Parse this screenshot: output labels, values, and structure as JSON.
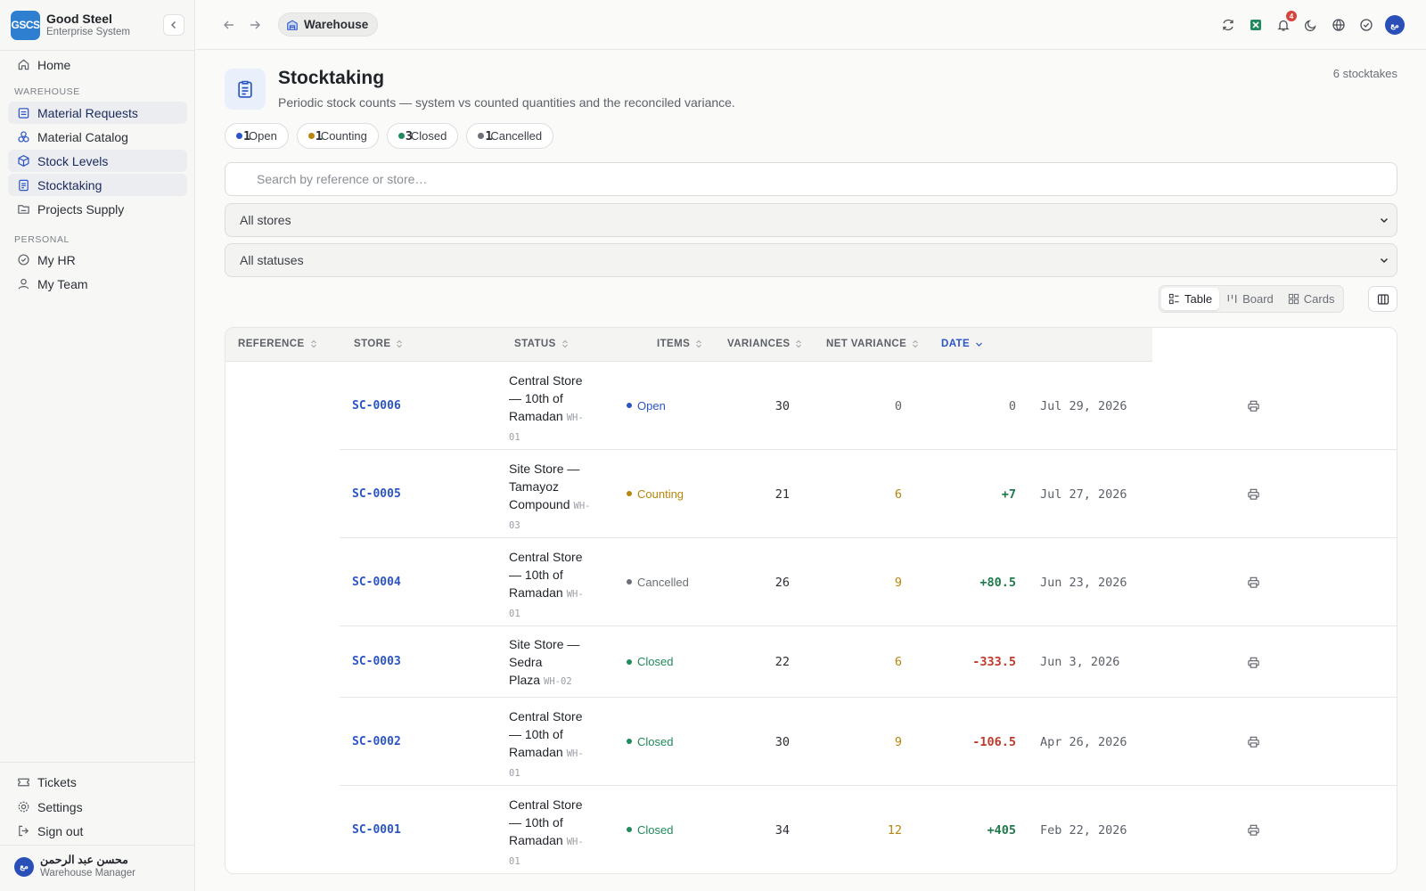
{
  "brand": {
    "logo": "GSCS",
    "name": "Good Steel",
    "subtitle": "Enterprise System"
  },
  "sidebar": {
    "home": "Home",
    "section_warehouse": "WAREHOUSE",
    "warehouse_items": [
      {
        "label": "Material Requests",
        "icon": "clipboard-icon",
        "active": true
      },
      {
        "label": "Material Catalog",
        "icon": "boxes-icon",
        "active": false
      },
      {
        "label": "Stock Levels",
        "icon": "cube-icon",
        "active": true
      },
      {
        "label": "Stocktaking",
        "icon": "checklist-icon",
        "active": true
      },
      {
        "label": "Projects Supply",
        "icon": "folder-icon",
        "active": false
      }
    ],
    "section_personal": "PERSONAL",
    "personal_items": [
      {
        "label": "My HR",
        "icon": "badge-check-icon"
      },
      {
        "label": "My Team",
        "icon": "user-icon"
      }
    ],
    "bottom_items": [
      {
        "label": "Tickets",
        "icon": "ticket-icon"
      },
      {
        "label": "Settings",
        "icon": "gear-icon"
      },
      {
        "label": "Sign out",
        "icon": "sign-out-icon"
      }
    ],
    "user": {
      "avatar": "مع",
      "name": "محسن عبد الرحمن",
      "role": "Warehouse Manager"
    }
  },
  "topbar": {
    "breadcrumb": "Warehouse",
    "notifications_count": "4",
    "avatar": "مع",
    "icons": [
      "refresh-icon",
      "excel-icon",
      "bell-icon",
      "moon-icon",
      "globe-icon",
      "check-circle-icon"
    ]
  },
  "page": {
    "title": "Stocktaking",
    "subtitle": "Periodic stock counts — system vs counted quantities and the reconciled variance.",
    "count_label": "6 stocktakes"
  },
  "chips": [
    {
      "label": "Open",
      "count": "1",
      "color": "#2b54c5"
    },
    {
      "label": "Counting",
      "count": "1",
      "color": "#b8860b"
    },
    {
      "label": "Closed",
      "count": "3",
      "color": "#1f8a5b"
    },
    {
      "label": "Cancelled",
      "count": "1",
      "color": "#6b6f76"
    }
  ],
  "filters": {
    "search_placeholder": "Search by reference or store…",
    "store_select": "All stores",
    "status_select": "All statuses"
  },
  "views": {
    "table": "Table",
    "board": "Board",
    "cards": "Cards"
  },
  "table": {
    "columns": [
      "REFERENCE",
      "STORE",
      "STATUS",
      "ITEMS",
      "VARIANCES",
      "NET VARIANCE",
      "DATE"
    ],
    "rows": [
      {
        "ref": "SC-0006",
        "store_lines": [
          "Central Store",
          "— 10th of",
          "Ramadan"
        ],
        "code_a": "WH-",
        "code_b": "01",
        "status": "Open",
        "status_color": "#2b54c5",
        "items": "30",
        "variances": "0",
        "variances_color": "#5d6168",
        "net": "0",
        "net_color": "#5d6168",
        "date": "Jul 29, 2026"
      },
      {
        "ref": "SC-0005",
        "store_lines": [
          "Site Store —",
          "Tamayoz",
          "Compound"
        ],
        "code_a": "WH-",
        "code_b": "03",
        "status": "Counting",
        "status_color": "#b8860b",
        "items": "21",
        "variances": "6",
        "variances_color": "#b8860b",
        "net": "+7",
        "net_color": "#1f7a4d",
        "date": "Jul 27, 2026"
      },
      {
        "ref": "SC-0004",
        "store_lines": [
          "Central Store",
          "— 10th of",
          "Ramadan"
        ],
        "code_a": "WH-",
        "code_b": "01",
        "status": "Cancelled",
        "status_color": "#6b6f76",
        "items": "26",
        "variances": "9",
        "variances_color": "#b8860b",
        "net": "+80.5",
        "net_color": "#1f7a4d",
        "date": "Jun 23, 2026"
      },
      {
        "ref": "SC-0003",
        "store_lines": [
          "Site Store —",
          "Sedra",
          "Plaza"
        ],
        "code_a": "WH-02",
        "code_b": "",
        "status": "Closed",
        "status_color": "#1f8a5b",
        "items": "22",
        "variances": "6",
        "variances_color": "#b8860b",
        "net": "-333.5",
        "net_color": "#c0392b",
        "date": "Jun 3, 2026"
      },
      {
        "ref": "SC-0002",
        "store_lines": [
          "Central Store",
          "— 10th of",
          "Ramadan"
        ],
        "code_a": "WH-",
        "code_b": "01",
        "status": "Closed",
        "status_color": "#1f8a5b",
        "items": "30",
        "variances": "9",
        "variances_color": "#b8860b",
        "net": "-106.5",
        "net_color": "#c0392b",
        "date": "Apr 26, 2026"
      },
      {
        "ref": "SC-0001",
        "store_lines": [
          "Central Store",
          "— 10th of",
          "Ramadan"
        ],
        "code_a": "WH-",
        "code_b": "01",
        "status": "Closed",
        "status_color": "#1f8a5b",
        "items": "34",
        "variances": "12",
        "variances_color": "#b8860b",
        "net": "+405",
        "net_color": "#1f7a4d",
        "date": "Feb 22, 2026"
      }
    ]
  }
}
